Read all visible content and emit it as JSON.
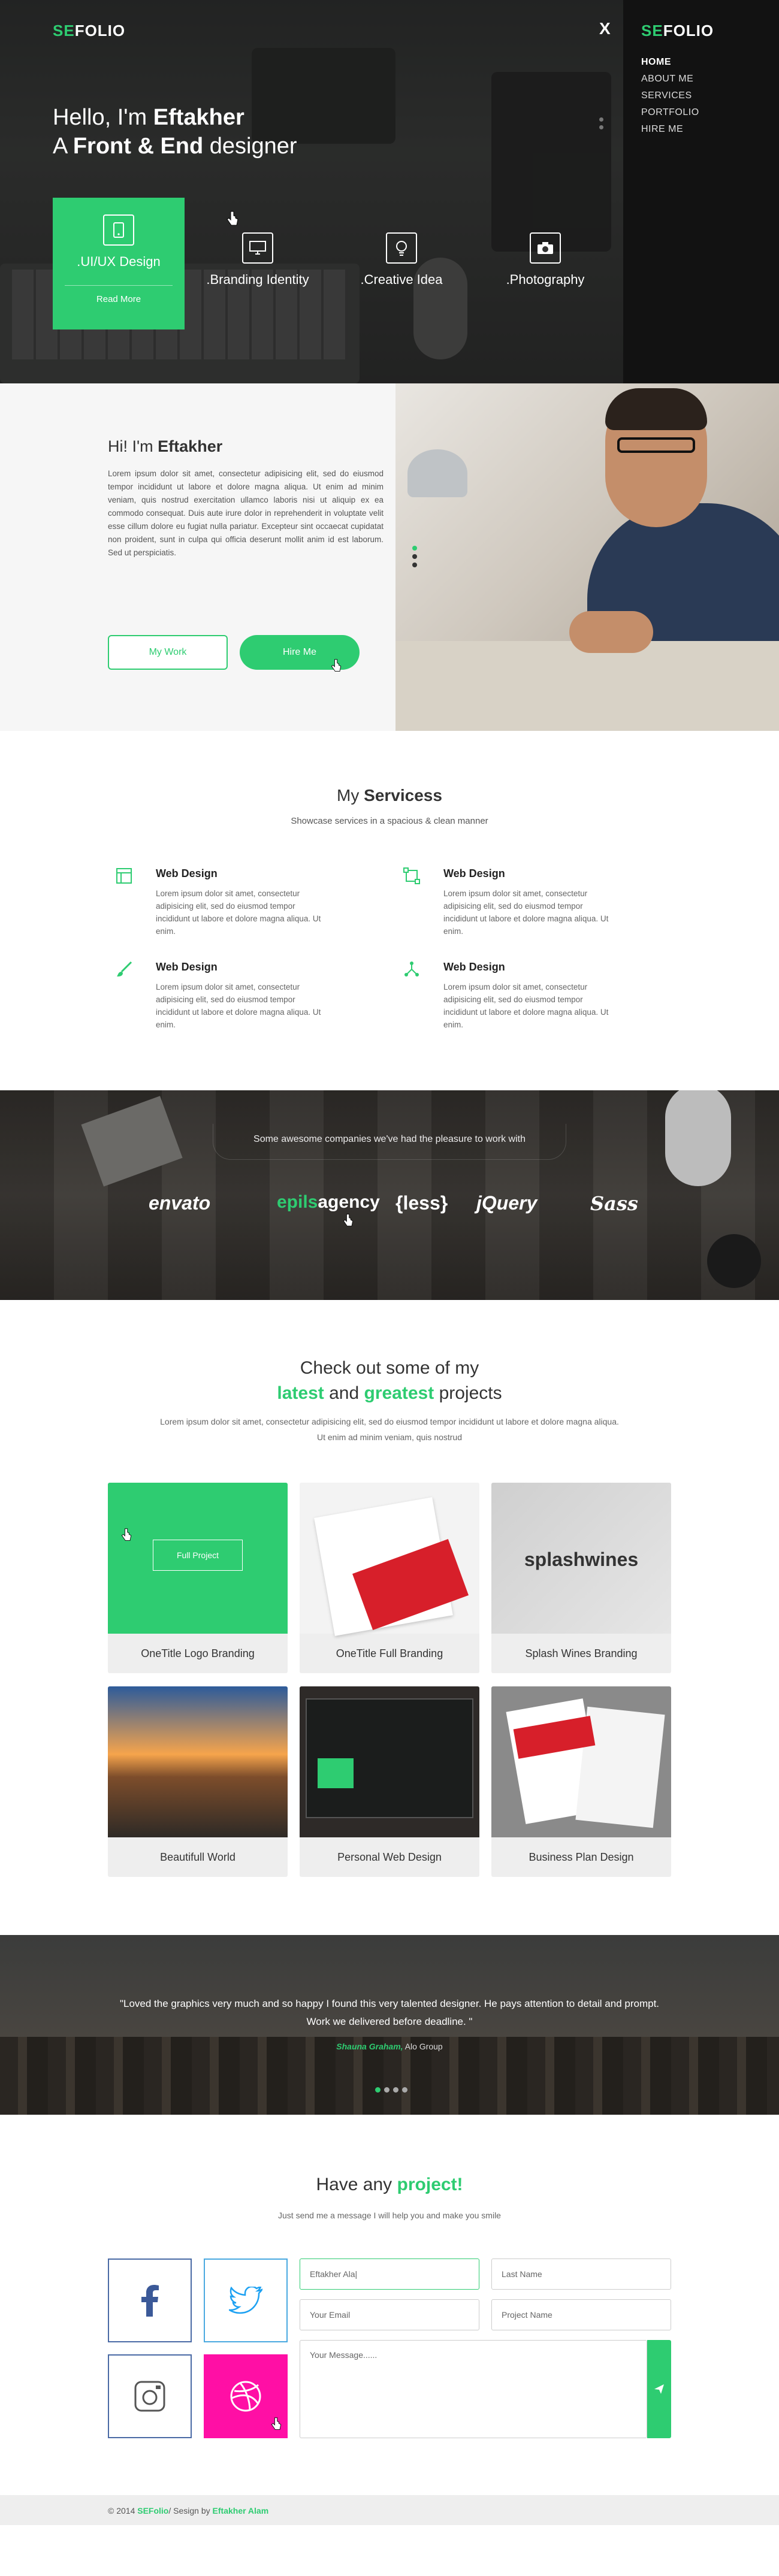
{
  "brand": {
    "prefix": "SE",
    "suffix": "FOLIO"
  },
  "hero": {
    "greeting": "Hello, I'm",
    "name": "Eftakher",
    "line2_prefix": "A",
    "line2_bold": "Front & End",
    "line2_suffix": "designer",
    "close": "X",
    "cards": [
      {
        "label": ".UI/UX Design",
        "icon": "mobile-icon",
        "more": "Read More"
      },
      {
        "label": ".Branding Identity",
        "icon": "monitor-icon"
      },
      {
        "label": ".Creative Idea",
        "icon": "bulb-icon"
      },
      {
        "label": ".Photography",
        "icon": "camera-icon"
      }
    ]
  },
  "menu": {
    "items": [
      "HOME",
      "ABOUT ME",
      "SERVICES",
      "PORTFOLIO",
      "HIRE ME"
    ],
    "active": "HOME"
  },
  "about": {
    "heading_prefix": "Hi! I'm",
    "heading_name": "Eftakher",
    "text": "Lorem ipsum dolor sit amet, consectetur adipisicing elit, sed do eiusmod tempor incididunt ut labore et dolore magna aliqua. Ut enim ad minim veniam, quis nostrud exercitation ullamco laboris nisi ut aliquip ex ea commodo consequat. Duis aute irure dolor in reprehenderit in voluptate velit esse cillum dolore eu fugiat nulla pariatur. Excepteur sint occaecat cupidatat non proident, sunt in culpa qui officia deserunt mollit anim id est laborum. Sed ut perspiciatis.",
    "btn_work": "My Work",
    "btn_hire": "Hire Me"
  },
  "services": {
    "title_prefix": "My",
    "title_bold": "Servicess",
    "subtitle": "Showcase services in a spacious & clean manner",
    "items": [
      {
        "title": "Web Design",
        "icon": "layout-icon",
        "text": "Lorem ipsum dolor sit amet, consectetur adipisicing elit, sed do eiusmod tempor incididunt ut labore et dolore magna aliqua. Ut enim."
      },
      {
        "title": "Web Design",
        "icon": "vector-icon",
        "text": "Lorem ipsum dolor sit amet, consectetur adipisicing elit, sed do eiusmod tempor incididunt ut labore et dolore magna aliqua. Ut enim."
      },
      {
        "title": "Web Design",
        "icon": "brush-icon",
        "text": "Lorem ipsum dolor sit amet, consectetur adipisicing elit, sed do eiusmod tempor incididunt ut labore et dolore magna aliqua. Ut enim."
      },
      {
        "title": "Web Design",
        "icon": "network-icon",
        "text": "Lorem ipsum dolor sit amet, consectetur adipisicing elit, sed do eiusmod tempor incididunt ut labore et dolore magna aliqua. Ut enim."
      }
    ]
  },
  "clients": {
    "title": "Some awesome companies we've had the pleasure to work with",
    "logos": [
      "envato",
      "epils",
      "agency",
      "{less}",
      "jQuery",
      "Sass"
    ]
  },
  "portfolio": {
    "title_line1": "Check out some of my",
    "title_g1": "latest",
    "title_and": "and",
    "title_g2": "greatest",
    "title_end": "projects",
    "subtitle": "Lorem ipsum dolor sit amet, consectetur adipisicing elit, sed do eiusmod tempor incididunt ut labore et dolore magna aliqua. Ut enim ad minim veniam, quis nostrud",
    "overlay_button": "Full Project",
    "tile3_text": "splashwines",
    "items": [
      "OneTitle Logo Branding",
      "OneTitle Full Branding",
      "Splash Wines Branding",
      "Beautifull World",
      "Personal Web Design",
      "Business Plan Design"
    ]
  },
  "testimonial": {
    "quote": "\"Loved the graphics very much and so happy I found this very talented designer. He pays attention to detail and prompt. Work we delivered before deadline. \"",
    "author": "Shauna Graham,",
    "company": "Alo Group"
  },
  "contact": {
    "title_prefix": "Have any",
    "title_bold": "project!",
    "subtitle": "Just send me a message I will help you and make you smile",
    "name_value": "Eftakher Ala|",
    "last_placeholder": "Last Name",
    "email_placeholder": "Your Email",
    "project_placeholder": "Project Name",
    "message_placeholder": "Your Message......",
    "social": [
      "facebook-icon",
      "twitter-icon",
      "instagram-icon",
      "dribbble-icon"
    ]
  },
  "footer": {
    "copy": "© 2014",
    "brand": "SEFolio",
    "design_by": "/ Sesign by",
    "author": "Eftakher Alam"
  },
  "colors": {
    "accent": "#2ecc71",
    "dark": "#121212",
    "dribbble": "#ff0fa5"
  }
}
